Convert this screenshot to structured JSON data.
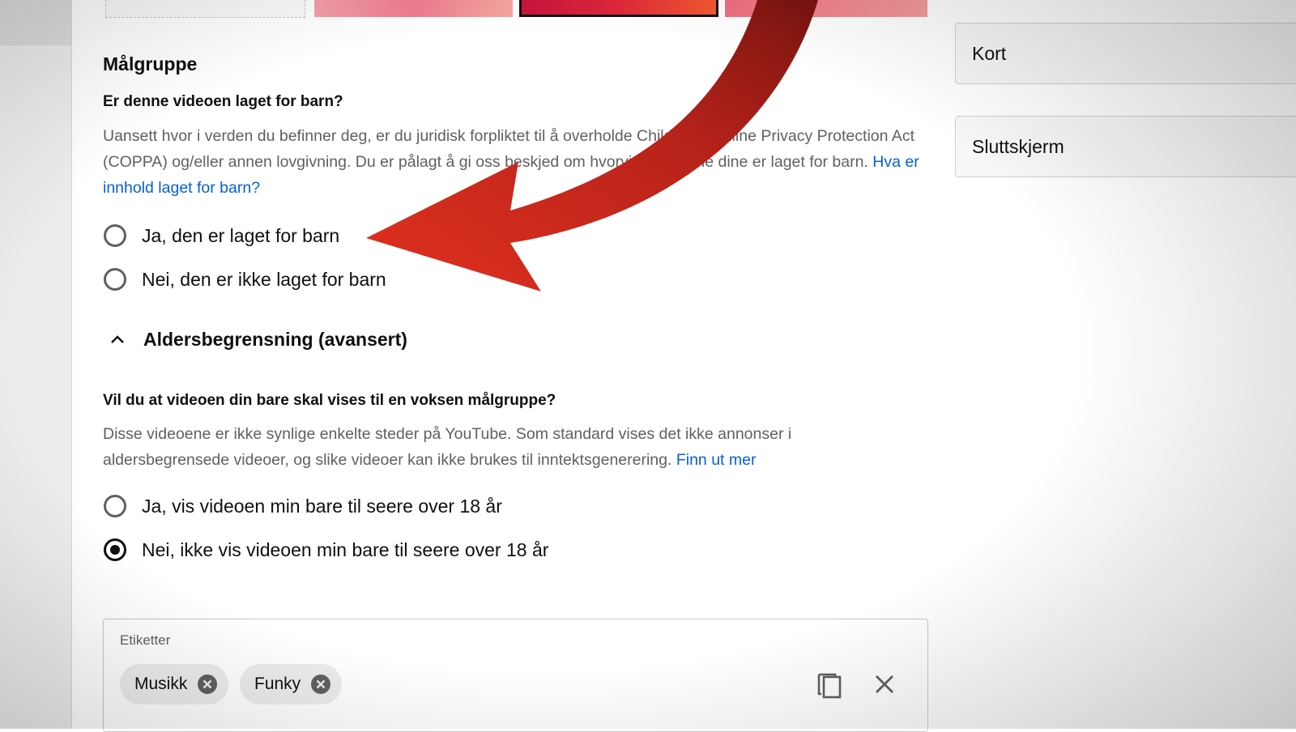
{
  "audience": {
    "section_title": "Målgruppe",
    "question": "Er denne videoen laget for barn?",
    "description": "Uansett hvor i verden du befinner deg, er du juridisk forpliktet til å overholde Children's Online Privacy Protection Act (COPPA) og/eller annen lovgivning. Du er pålagt å gi oss beskjed om hvorvidt videoene dine er laget for barn.",
    "link": "Hva er innhold laget for barn?",
    "options": [
      {
        "label": "Ja, den er laget for barn",
        "selected": false
      },
      {
        "label": "Nei, den er ikke laget for barn",
        "selected": false
      }
    ]
  },
  "age_restriction": {
    "toggle_label": "Aldersbegrensning (avansert)",
    "expanded": true,
    "question": "Vil du at videoen din bare skal vises til en voksen målgruppe?",
    "description": "Disse videoene er ikke synlige enkelte steder på YouTube. Som standard vises det ikke annonser i aldersbegrensede videoer, og slike videoer kan ikke brukes til inntektsgenerering.",
    "link": "Finn ut mer",
    "options": [
      {
        "label": "Ja, vis videoen min bare til seere over 18 år",
        "selected": false
      },
      {
        "label": "Nei, ikke vis videoen min bare til seere over 18 år",
        "selected": true
      }
    ]
  },
  "tags": {
    "label": "Etiketter",
    "chips": [
      "Musikk",
      "Funky"
    ]
  },
  "side_panel": {
    "cards": [
      "Kort",
      "Sluttskjerm"
    ]
  },
  "colors": {
    "link": "#065fd4",
    "arrow": "#c8261c"
  }
}
